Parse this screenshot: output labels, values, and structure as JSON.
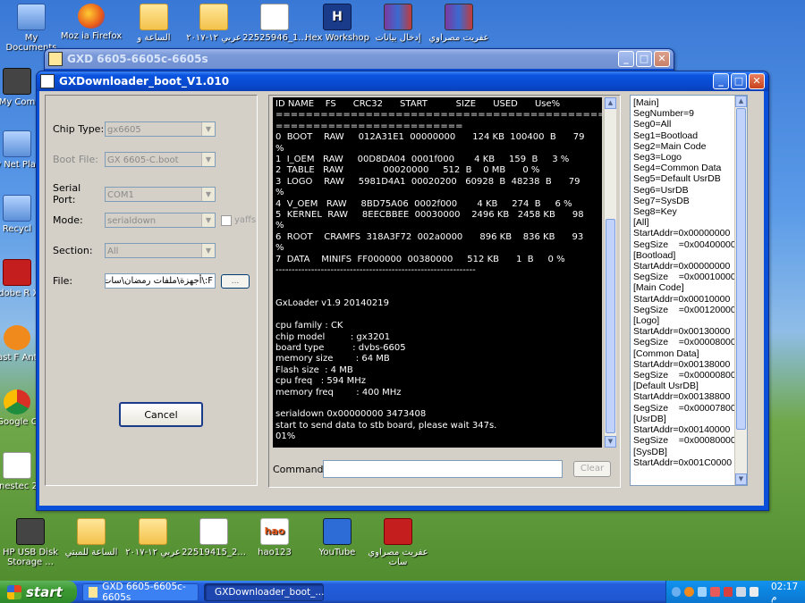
{
  "desktop": {
    "icons_top": [
      {
        "label": "My Documents",
        "icon": "folder-icon"
      },
      {
        "label": "Moz ia Firefox",
        "icon": "firefox-icon"
      },
      {
        "label": "الساعة و",
        "icon": "folder-icon"
      },
      {
        "label": "عربي ١٢-٢٠١٧",
        "icon": "folder-icon"
      },
      {
        "label": "22525946_1...",
        "icon": "file-icon"
      },
      {
        "label": "Hex Workshop",
        "icon": "hex-icon"
      },
      {
        "label": "إدخال بيانات",
        "icon": "rar-icon"
      },
      {
        "label": "عفريت مصراوي",
        "icon": "rar-icon"
      }
    ],
    "icons_left": [
      {
        "label": "My Com",
        "icon": "computer-icon"
      },
      {
        "label": "My Net Place",
        "icon": "network-icon"
      },
      {
        "label": "Recycl",
        "icon": "recycle-icon"
      },
      {
        "label": "Adobe R XI",
        "icon": "pdf-icon"
      },
      {
        "label": "Avast F Antivi",
        "icon": "avast-icon"
      },
      {
        "label": "Google C",
        "icon": "chrome-icon"
      },
      {
        "label": "honestec 2.5",
        "icon": "app-icon"
      },
      {
        "label": "HP USB Disk Storage ...",
        "icon": "usb-icon"
      }
    ],
    "icons_bottom": [
      {
        "label": "الساعة للمبتي",
        "icon": "folder-icon"
      },
      {
        "label": "عربي ١٢-٢٠١٧",
        "icon": "folder-icon"
      },
      {
        "label": "22519415_2...",
        "icon": "file-icon"
      },
      {
        "label": "hao123",
        "icon": "hao-icon"
      },
      {
        "label": "YouTube",
        "icon": "youtube-icon"
      },
      {
        "label": "عفريت مصراوي سات",
        "icon": "app-icon"
      }
    ]
  },
  "back_window": {
    "title": "GXD 6605-6605c-6605s"
  },
  "main_window": {
    "title": "GXDownloader_boot_V1.010",
    "form": {
      "chip_type": {
        "label": "Chip Type:",
        "value": "gx6605"
      },
      "boot_file": {
        "label": "Boot File:",
        "value": "GX 6605-C.boot"
      },
      "serial_port": {
        "label": "Serial Port:",
        "value": "COM1"
      },
      "mode": {
        "label": "Mode:",
        "value": "serialdown",
        "yaffs_label": "yaffs"
      },
      "section": {
        "label": "Section:",
        "value": "All"
      },
      "file": {
        "label": "File:",
        "value": "F:\\أجهزة\\ملفات رمضان\\سات",
        "browse_label": "..."
      }
    },
    "cancel_label": "Cancel",
    "console_lines": [
      "ID NAME    FS      CRC32      START          SIZE      USED      Use%",
      "=============================================================",
      "=========================",
      "0  BOOT    RAW     012A31E1  00000000      124 KB  100400  B      79",
      "%",
      "1  I_OEM   RAW     00D8DA04  0001f000       4 KB     159  B     3 %",
      "2  TABLE   RAW              00020000     512  B    0 MB      0 %",
      "3  LOGO    RAW     5981D4A1  00020200   60928  B  48238  B      79",
      "%",
      "4  V_OEM   RAW     8BD75A06  0002f000       4 KB     274  B     6 %",
      "5  KERNEL  RAW     8EECBBEE  00030000    2496 KB   2458 KB      98",
      "%",
      "6  ROOT    CRAMFS  318A3F72  002a0000      896 KB    836 KB      93",
      "%",
      "7  DATA    MINIFS  FF000000  00380000     512 KB      1  B     0 %",
      "--------------------------------------------------------------",
      "",
      "",
      "GxLoader v1.9 20140219",
      "",
      "cpu family : CK",
      "chip model         : gx3201",
      "board type          : dvbs-6605",
      "memory size        : 64 MB",
      "Flash size  : 4 MB",
      "cpu freq   : 594 MHz",
      "memory freq        : 400 MHz",
      "",
      "serialdown 0x00000000 3473408",
      "start to send data to stb board, please wait 347s.",
      "01%"
    ],
    "command_label": "Command:",
    "command_value": "",
    "clear_label": "Clear",
    "info_lines": [
      "[Main]",
      "SegNumber=9",
      "Seg0=All",
      "Seg1=Bootload",
      "Seg2=Main Code",
      "Seg3=Logo",
      "Seg4=Common Data",
      "Seg5=Default UsrDB",
      "Seg6=UsrDB",
      "Seg7=SysDB",
      "Seg8=Key",
      "[All]",
      "StartAddr=0x00000000",
      "SegSize    =0x00400000",
      "[Bootload]",
      "StartAddr=0x00000000",
      "SegSize    =0x00010000",
      "[Main Code]",
      "StartAddr=0x00010000",
      "SegSize    =0x00120000",
      "[Logo]",
      "StartAddr=0x00130000",
      "SegSize    =0x00008000",
      "[Common Data]",
      "StartAddr=0x00138000",
      "SegSize    =0x00000800",
      "[Default UsrDB]",
      "StartAddr=0x00138800",
      "SegSize    =0x00007800",
      "[UsrDB]",
      "StartAddr=0x00140000",
      "SegSize    =0x00080000",
      "[SysDB]",
      "StartAddr=0x001C0000"
    ]
  },
  "taskbar": {
    "start_label": "start",
    "tasks": [
      {
        "label": "GXD 6605-6605c-6605s"
      },
      {
        "label": "GXDownloader_boot_..."
      }
    ],
    "clock": "02:17 م"
  }
}
